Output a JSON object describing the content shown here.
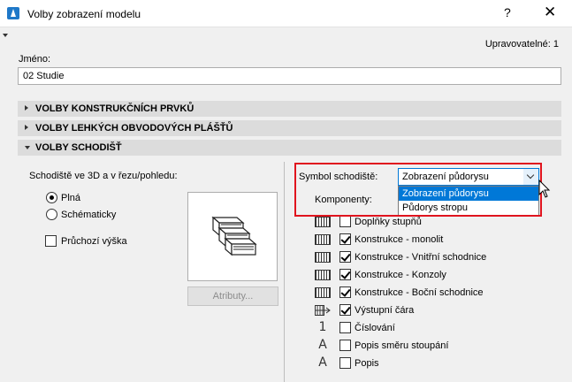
{
  "window": {
    "title": "Volby zobrazení modelu",
    "help": "?",
    "close": "✕"
  },
  "editable_label": "Upravovatelné: 1",
  "name": {
    "label": "Jméno:",
    "value": "02 Studie"
  },
  "sections": [
    {
      "label": "VOLBY KONSTRUKČNÍCH PRVKŮ",
      "expanded": false
    },
    {
      "label": "VOLBY LEHKÝCH OBVODOVÝCH PLÁŠŤŮ",
      "expanded": false
    },
    {
      "label": "VOLBY SCHODIŠŤ",
      "expanded": true
    }
  ],
  "stairs": {
    "view_label": "Schodiště ve 3D a v řezu/pohledu:",
    "radio_full": "Plná",
    "radio_schematic": "Schématicky",
    "radio_selected": "Plná",
    "walkline_label": "Průchozí výška",
    "walkline_checked": false,
    "attributes_button": "Atributy..."
  },
  "symbol": {
    "label": "Symbol schodiště:",
    "selected": "Zobrazení půdorysu",
    "options": [
      "Zobrazení půdorysu",
      "Půdorys stropu"
    ],
    "highlighted_option": 0
  },
  "components": {
    "label": "Komponenty:",
    "items": [
      {
        "label": "Doplňky stupňů",
        "checked": false,
        "icon": "hatch-icon"
      },
      {
        "label": "Konstrukce - monolit",
        "checked": true,
        "icon": "hatch-icon"
      },
      {
        "label": "Konstrukce - Vnitřní schodnice",
        "checked": true,
        "icon": "hatch-icon"
      },
      {
        "label": "Konstrukce - Konzoly",
        "checked": true,
        "icon": "hatch-icon"
      },
      {
        "label": "Konstrukce - Boční schodnice",
        "checked": true,
        "icon": "hatch-icon"
      },
      {
        "label": "Výstupní čára",
        "checked": true,
        "icon": "walkline-icon"
      },
      {
        "label": "Číslování",
        "checked": false,
        "icon": "numbering-icon",
        "glyph": "1"
      },
      {
        "label": "Popis směru stoupání",
        "checked": false,
        "icon": "text-icon",
        "glyph": "A"
      },
      {
        "label": "Popis",
        "checked": false,
        "icon": "text-icon",
        "glyph": "A"
      }
    ]
  },
  "colors": {
    "accent": "#0078d7",
    "highlight_border": "#e0141e",
    "section_bg": "#dcdcdc"
  }
}
